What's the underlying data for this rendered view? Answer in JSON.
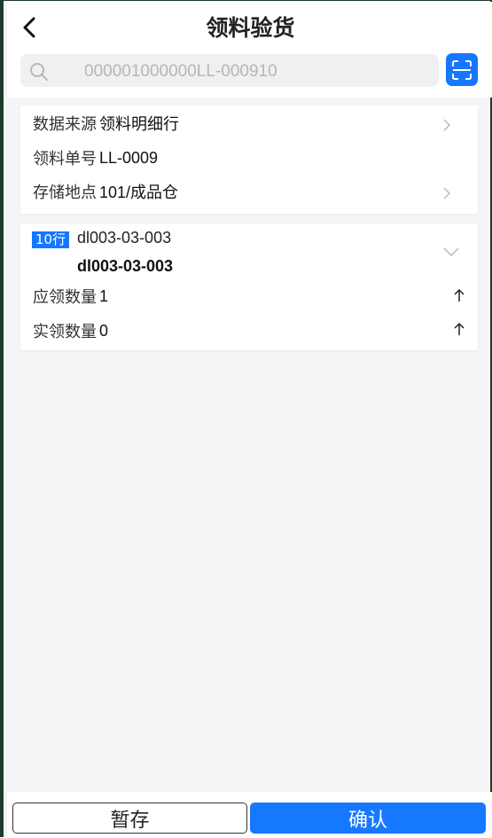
{
  "header": {
    "title": "领料验货"
  },
  "search": {
    "placeholder": "000001000000LL-000910"
  },
  "info_card": {
    "data_source_label": "数据来源",
    "data_source_value": "领料明细行",
    "order_no_label": "领料单号",
    "order_no_value": "LL-0009",
    "location_label": "存储地点",
    "location_value": "101/成品仓"
  },
  "item_card": {
    "line_badge": "10行",
    "item_code": "dl003-03-003",
    "item_name": "dl003-03-003",
    "required_qty_label": "应领数量",
    "required_qty_value": "1",
    "actual_qty_label": "实领数量",
    "actual_qty_value": "0"
  },
  "footer": {
    "save_label": "暂存",
    "confirm_label": "确认"
  },
  "colors": {
    "accent": "#1677ff",
    "background": "#f4f5f7"
  }
}
